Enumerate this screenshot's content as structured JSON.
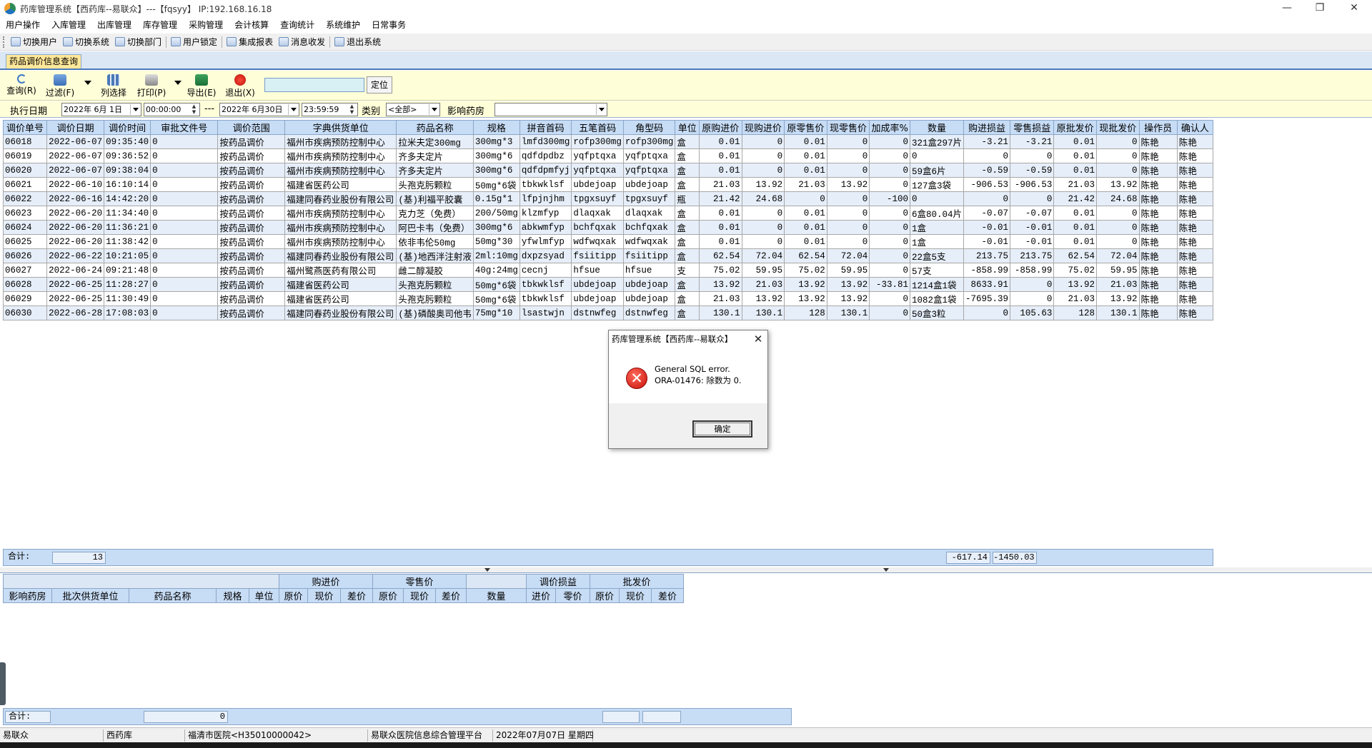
{
  "window": {
    "title": "药库管理系统【西药库--易联众】---【fqsyy】 IP:192.168.16.18",
    "minimize_glyph": "—",
    "restore_glyph": "❐",
    "close_glyph": "✕"
  },
  "menubar": [
    "用户操作",
    "入库管理",
    "出库管理",
    "库存管理",
    "采购管理",
    "会计核算",
    "查询统计",
    "系统维护",
    "日常事务"
  ],
  "toolbar": [
    "切换用户",
    "切换系统",
    "切换部门",
    "用户锁定",
    "集成报表",
    "消息收发",
    "退出系统"
  ],
  "tab": {
    "label": "药品调价信息查询"
  },
  "actions": {
    "query": "查询(R)",
    "filter": "过滤(F)",
    "columns": "列选择",
    "print": "打印(P)",
    "export": "导出(E)",
    "exit": "退出(X)",
    "locate_value": "",
    "locate": "定位"
  },
  "filter": {
    "date_label": "执行日期",
    "start_date": "2022年 6月 1日",
    "start_time": "00:00:00",
    "range_sep": "---",
    "end_date": "2022年 6月30日",
    "end_time": "23:59:59",
    "category_label": "类别",
    "category_value": "<全部>",
    "pharmacy_label": "影响药房",
    "pharmacy_value": ""
  },
  "main_table": {
    "columns": [
      "调价单号",
      "调价日期",
      "调价时间",
      "审批文件号",
      "调价范围",
      "字典供货单位",
      "药品名称",
      "规格",
      "拼音首码",
      "五笔首码",
      "角型码",
      "单位",
      "原购进价",
      "现购进价",
      "原零售价",
      "现零售价",
      "加成率%",
      "数量",
      "购进损益",
      "零售损益",
      "原批发价",
      "现批发价",
      "操作员",
      "确认人"
    ],
    "rows": [
      [
        "06018",
        "2022-06-07",
        "09:35:40",
        "0",
        "按药品调价",
        "福州市疾病预防控制中心",
        "拉米夫定300mg",
        "300mg*3",
        "lmfd300mg",
        "rofp300mg",
        "rofp300mg",
        "盒",
        "0.01",
        "0",
        "0.01",
        "0",
        "0",
        "321盒297片",
        "-3.21",
        "-3.21",
        "0.01",
        "0",
        "陈艳",
        "陈艳"
      ],
      [
        "06019",
        "2022-06-07",
        "09:36:52",
        "0",
        "按药品调价",
        "福州市疾病预防控制中心",
        "齐多夫定片",
        "300mg*6",
        "qdfdpdbz",
        "yqfptqxa",
        "yqfptqxa",
        "盒",
        "0.01",
        "0",
        "0.01",
        "0",
        "0",
        "0",
        "0",
        "0",
        "0.01",
        "0",
        "陈艳",
        "陈艳"
      ],
      [
        "06020",
        "2022-06-07",
        "09:38:04",
        "0",
        "按药品调价",
        "福州市疾病预防控制中心",
        "齐多夫定片",
        "300mg*6",
        "qdfdpmfyj",
        "yqfptqxa",
        "yqfptqxa",
        "盒",
        "0.01",
        "0",
        "0.01",
        "0",
        "0",
        "59盒6片",
        "-0.59",
        "-0.59",
        "0.01",
        "0",
        "陈艳",
        "陈艳"
      ],
      [
        "06021",
        "2022-06-10",
        "16:10:14",
        "0",
        "按药品调价",
        "福建省医药公司",
        "头孢克肟颗粒",
        "50mg*6袋",
        "tbkwklsf",
        "ubdejoap",
        "ubdejoap",
        "盒",
        "21.03",
        "13.92",
        "21.03",
        "13.92",
        "0",
        "127盒3袋",
        "-906.53",
        "-906.53",
        "21.03",
        "13.92",
        "陈艳",
        "陈艳"
      ],
      [
        "06022",
        "2022-06-16",
        "14:42:20",
        "0",
        "按药品调价",
        "福建同春药业股份有限公司",
        "(基)利福平胶囊",
        "0.15g*1",
        "lfpjnjhm",
        "tpgxsuyf",
        "tpgxsuyf",
        "瓶",
        "21.42",
        "24.68",
        "0",
        "0",
        "-100",
        "0",
        "0",
        "0",
        "21.42",
        "24.68",
        "陈艳",
        "陈艳"
      ],
      [
        "06023",
        "2022-06-20",
        "11:34:40",
        "0",
        "按药品调价",
        "福州市疾病预防控制中心",
        "克力芝（免费）",
        "200/50mg",
        "klzmfyp",
        "dlaqxak",
        "dlaqxak",
        "盒",
        "0.01",
        "0",
        "0.01",
        "0",
        "0",
        "6盒80.04片",
        "-0.07",
        "-0.07",
        "0.01",
        "0",
        "陈艳",
        "陈艳"
      ],
      [
        "06024",
        "2022-06-20",
        "11:36:21",
        "0",
        "按药品调价",
        "福州市疾病预防控制中心",
        "阿巴卡韦（免费）",
        "300mg*6",
        "abkwmfyp",
        "bchfqxak",
        "bchfqxak",
        "盒",
        "0.01",
        "0",
        "0.01",
        "0",
        "0",
        "1盒",
        "-0.01",
        "-0.01",
        "0.01",
        "0",
        "陈艳",
        "陈艳"
      ],
      [
        "06025",
        "2022-06-20",
        "11:38:42",
        "0",
        "按药品调价",
        "福州市疾病预防控制中心",
        "依非韦伦50mg",
        "50mg*30",
        "yfwlmfyp",
        "wdfwqxak",
        "wdfwqxak",
        "盒",
        "0.01",
        "0",
        "0.01",
        "0",
        "0",
        "1盒",
        "-0.01",
        "-0.01",
        "0.01",
        "0",
        "陈艳",
        "陈艳"
      ],
      [
        "06026",
        "2022-06-22",
        "10:21:05",
        "0",
        "按药品调价",
        "福建同春药业股份有限公司",
        "(基)地西泮注射液",
        "2ml:10mg",
        "dxpzsyad",
        "fsiitipp",
        "fsiitipp",
        "盒",
        "62.54",
        "72.04",
        "62.54",
        "72.04",
        "0",
        "22盒5支",
        "213.75",
        "213.75",
        "62.54",
        "72.04",
        "陈艳",
        "陈艳"
      ],
      [
        "06027",
        "2022-06-24",
        "09:21:48",
        "0",
        "按药品调价",
        "福州鹭燕医药有限公司",
        "雌二醇凝胶",
        "40g:24mg",
        "cecnj",
        "hfsue",
        "hfsue",
        "支",
        "75.02",
        "59.95",
        "75.02",
        "59.95",
        "0",
        "57支",
        "-858.99",
        "-858.99",
        "75.02",
        "59.95",
        "陈艳",
        "陈艳"
      ],
      [
        "06028",
        "2022-06-25",
        "11:28:27",
        "0",
        "按药品调价",
        "福建省医药公司",
        "头孢克肟颗粒",
        "50mg*6袋",
        "tbkwklsf",
        "ubdejoap",
        "ubdejoap",
        "盒",
        "13.92",
        "21.03",
        "13.92",
        "13.92",
        "-33.81",
        "1214盒1袋",
        "8633.91",
        "0",
        "13.92",
        "21.03",
        "陈艳",
        "陈艳"
      ],
      [
        "06029",
        "2022-06-25",
        "11:30:49",
        "0",
        "按药品调价",
        "福建省医药公司",
        "头孢克肟颗粒",
        "50mg*6袋",
        "tbkwklsf",
        "ubdejoap",
        "ubdejoap",
        "盒",
        "21.03",
        "13.92",
        "13.92",
        "13.92",
        "0",
        "1082盒1袋",
        "-7695.39",
        "0",
        "21.03",
        "13.92",
        "陈艳",
        "陈艳"
      ],
      [
        "06030",
        "2022-06-28",
        "17:08:03",
        "0",
        "按药品调价",
        "福建同春药业股份有限公司",
        "(基)磷酸奥司他韦",
        "75mg*10",
        "lsastwjn",
        "dstnwfeg",
        "dstnwfeg",
        "盒",
        "130.1",
        "130.1",
        "128",
        "130.1",
        "0",
        "50盒3粒",
        "0",
        "105.63",
        "128",
        "130.1",
        "陈艳",
        "陈艳"
      ]
    ],
    "summary": {
      "label": "合计:",
      "count": "13",
      "purchase_pl": "-617.14",
      "retail_pl": "-1450.03"
    }
  },
  "detail_table": {
    "group_headers": [
      "购进价",
      "零售价",
      "调价损益",
      "批发价"
    ],
    "columns": [
      "影响药房",
      "批次供货单位",
      "药品名称",
      "规格",
      "单位",
      "原价",
      "现价",
      "差价",
      "原价",
      "现价",
      "差价",
      "数量",
      "进价",
      "零价",
      "原价",
      "现价",
      "差价"
    ],
    "summary": {
      "label": "合计:",
      "value": "0"
    }
  },
  "statusbar": [
    "易联众",
    "西药库",
    "福清市医院<H35010000042>",
    "易联众医院信息综合管理平台",
    "2022年07月07日 星期四"
  ],
  "dialog": {
    "title": "药库管理系统【西药库--易联众】",
    "close_glyph": "✕",
    "icon_glyph": "✕",
    "message_line1": "General SQL error.",
    "message_line2": "ORA-01476: 除数为 0.",
    "ok_label": "确定"
  },
  "colors": {
    "header_bg": "#c7dcf5",
    "row_alt_bg": "#e6eef9",
    "action_bar_bg": "#fefed8",
    "active_tab_bg": "#ffe89a",
    "error_red": "#d42a1f"
  },
  "icons": [
    "app-logo-icon",
    "refresh-icon",
    "filter-icon",
    "columns-icon",
    "printer-icon",
    "excel-icon",
    "power-icon",
    "error-icon"
  ]
}
